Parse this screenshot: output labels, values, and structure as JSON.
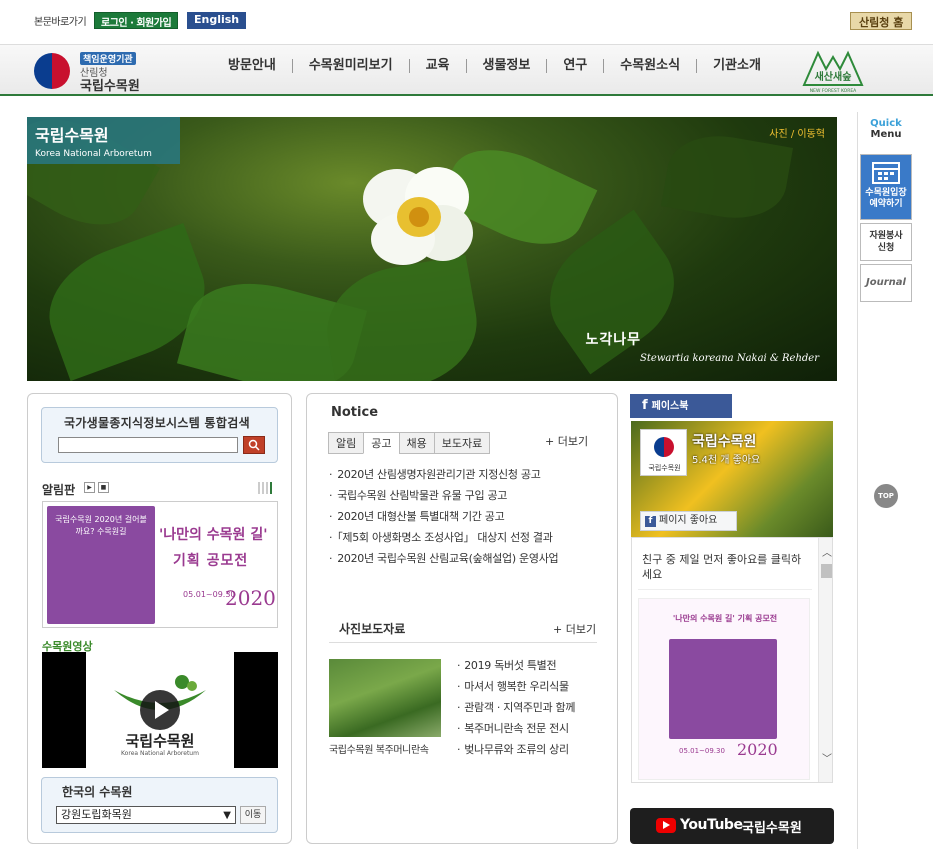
{
  "topbar": {
    "skip_link": "본문바로가기",
    "login_label": "로그인 · 회원가입",
    "english_label": "English",
    "forest_home_label": "산림청 홈"
  },
  "header": {
    "badge": "책임운영기관",
    "org_sub": "산림청",
    "org_name": "국립수목원",
    "nav": [
      "방문안내",
      "수목원미리보기",
      "교육",
      "생물정보",
      "연구",
      "수목원소식",
      "기관소개"
    ],
    "slogan": "새산새숲",
    "slogan_en": "NEW FOREST KOREA"
  },
  "hero": {
    "title_ko": "국립수목원",
    "title_en": "Korea National Arboretum",
    "photo_credit": "사진 / 이동혁",
    "species_ko": "노각나무",
    "species_sci": "Stewartia koreana Nakai & Rehder"
  },
  "quick_menu": {
    "title_a": "Quick",
    "title_b": "Menu",
    "reservation": "수목원입장 예약하기",
    "volunteer": "자원봉사 신청",
    "journal": "Journal",
    "top_label": "TOP"
  },
  "left": {
    "search_title": "국가생물종지식정보시스템 통합검색",
    "search_value": "",
    "notice_board": "알림판",
    "banner_small": "국립수목원 2020년 걸어볼까요? 수목원길",
    "banner_title": "'나만의 수목원 길'",
    "banner_sub": "기획 공모전",
    "banner_date": "05.01~09.30",
    "banner_year": "2020",
    "video_label": "수목원영상",
    "video_title": "국립수목원",
    "video_en": "Korea National Arboretum",
    "arboretum_title": "한국의 수목원",
    "arboretum_selected": "강원도립화목원",
    "go_label": "이동"
  },
  "center": {
    "title": "Notice",
    "tabs": [
      "알림",
      "공고",
      "채용",
      "보도자료"
    ],
    "active_tab": "공고",
    "more": "+ 더보기",
    "notices": [
      "2020년 산림생명자원관리기관 지정신청 공고",
      "국립수목원 산림박물관 유물 구입 공고",
      "2020년 대형산불 특별대책 기간 공고",
      "「제5회 아생화명소 조성사업」 대상지 선정 결과",
      "2020년 국립수목원 산림교육(숲해설업) 운영사업"
    ],
    "photo_title": "사진보도자료",
    "photo_caption": "국립수목원 복주머니란속",
    "photo_items": [
      "2019 독버섯 특별전",
      "마셔서 행복한 우리식물",
      "관람객 · 지역주민과 함께",
      "복주머니란속 전문 전시",
      "벚나무류와 조류의 상리"
    ]
  },
  "facebook": {
    "tab_label": "페이스북",
    "page_name": "국립수목원",
    "likes": "5.4천 개 좋아요",
    "like_button": "페이지 좋아요",
    "friend_prompt": "친구 중 제일 먼저 좋아요를 클릭하세요",
    "post_title": "'나만의 수목원 길' 기획 공모전",
    "post_date": "05.01~09.30",
    "post_year": "2020"
  },
  "youtube": {
    "wordmark": "YouTube",
    "channel": "국립수목원"
  },
  "colors": {
    "brand_green": "#2e7a3a",
    "facebook_blue": "#3b5998",
    "promo_purple": "#9a3a90",
    "quick_blue": "#3a7ac8"
  }
}
